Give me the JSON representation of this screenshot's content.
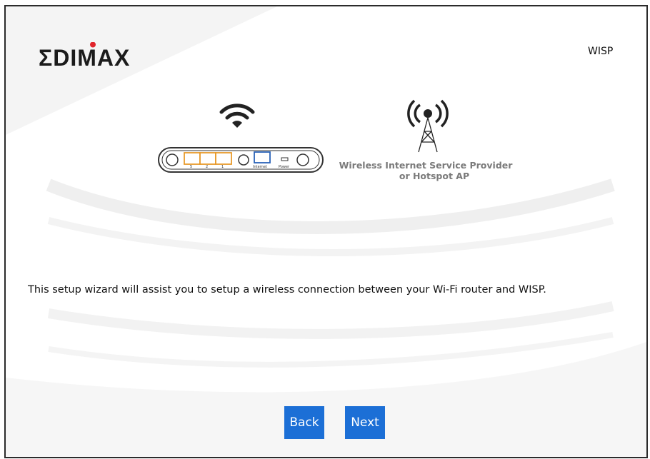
{
  "brand": {
    "logo_text": "EDIMAX",
    "accent_color": "#e0242b"
  },
  "mode_label": "WISP",
  "illustration": {
    "wifi_icon": "wifi-icon",
    "router_ports": [
      "5",
      "2",
      "1"
    ],
    "router_internet_label": "Internet",
    "router_power_label": "Power",
    "antenna_icon": "antenna-tower-icon",
    "provider_line1": "Wireless Internet Service Provider",
    "provider_line2": "or Hotspot AP"
  },
  "description": "This setup wizard will assist you to setup a wireless connection between your Wi-Fi router and WISP.",
  "buttons": {
    "back": "Back",
    "next": "Next",
    "color": "#1c6fd6"
  }
}
